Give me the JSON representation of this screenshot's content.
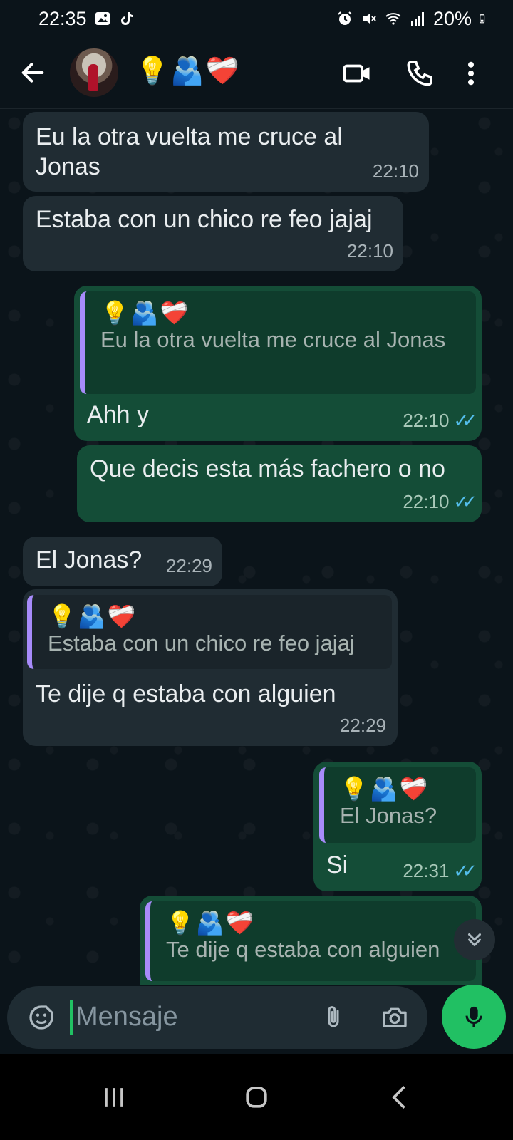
{
  "status_bar": {
    "time": "22:35",
    "battery": "20%",
    "icons": [
      "gallery-icon",
      "tiktok-icon",
      "alarm-icon",
      "mute-icon",
      "wifi-icon",
      "signal-icon",
      "battery-icon"
    ]
  },
  "header": {
    "contact_name": "💡🫂❤️‍🩹",
    "icons": [
      "back-arrow-icon",
      "video-call-icon",
      "voice-call-icon",
      "more-options-icon"
    ]
  },
  "messages": [
    {
      "direction": "in",
      "text": "Eu la otra vuelta me cruce al Jonas",
      "time": "22:10"
    },
    {
      "direction": "in",
      "text": "Estaba con un chico re feo jajaj",
      "time": "22:10"
    },
    {
      "direction": "out",
      "quote_author": "💡🫂❤️‍🩹",
      "quote_text": "Eu la otra vuelta me cruce al Jonas",
      "text": "Ahh y",
      "time": "22:10",
      "read": true
    },
    {
      "direction": "out",
      "text": "Que decis esta más fachero o no",
      "time": "22:10",
      "read": true
    },
    {
      "direction": "in",
      "text": "El Jonas?",
      "time": "22:29"
    },
    {
      "direction": "in",
      "quote_author": "💡🫂❤️‍🩹",
      "quote_text": "Estaba con un chico re feo jajaj",
      "text": "Te dije q estaba con alguien",
      "time": "22:29"
    },
    {
      "direction": "out",
      "quote_author": "💡🫂❤️‍🩹",
      "quote_text": "El Jonas?",
      "text": "Si",
      "time": "22:31",
      "read": true
    },
    {
      "direction": "out",
      "quote_author": "💡🫂❤️‍🩹",
      "quote_text": "Te dije q estaba con alguien",
      "text": "",
      "time": "",
      "read": true
    }
  ],
  "composer": {
    "placeholder": "Mensaje",
    "icons": [
      "emoji-sticker-icon",
      "attach-icon",
      "camera-icon",
      "microphone-icon"
    ]
  },
  "colors": {
    "background": "#0b141a",
    "incoming_bubble": "#202c33",
    "outgoing_bubble": "#144d37",
    "accent_green": "#21c063",
    "read_ticks": "#53bdeb",
    "quote_bar": "#a78bfa"
  }
}
